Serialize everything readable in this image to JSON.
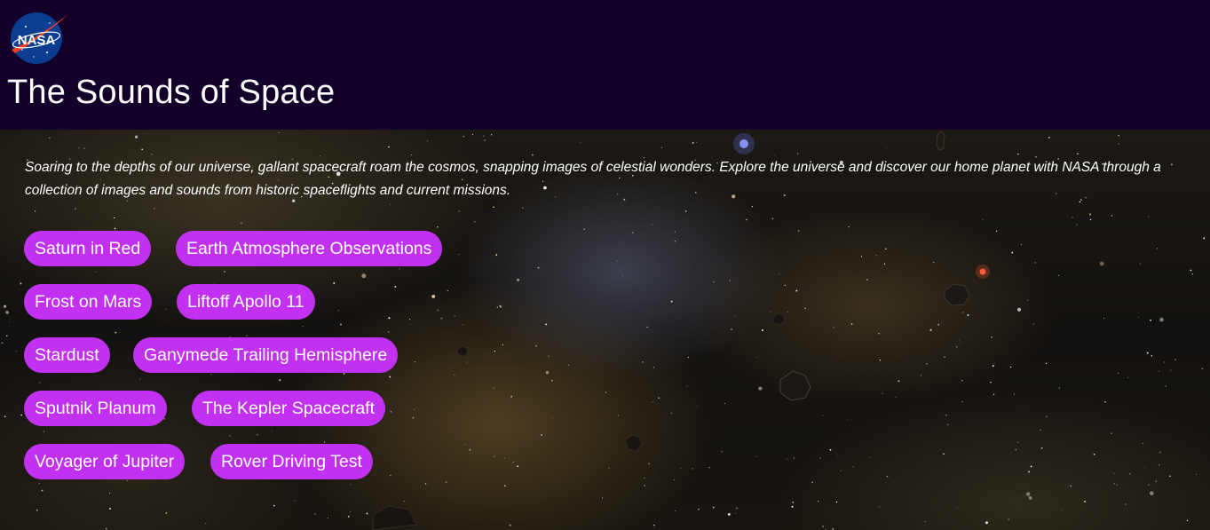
{
  "header": {
    "logo_text": "NASA",
    "title": "The Sounds of Space"
  },
  "intro": {
    "text": "Soaring to the depths of our universe, gallant spacecraft roam the cosmos, snapping images of celestial wonders. Explore the universe and discover our home planet with NASA through a collection of images and sounds from historic spaceflights and current missions."
  },
  "sounds": [
    [
      "Saturn in Red",
      "Earth Atmosphere Observations"
    ],
    [
      "Frost on Mars",
      "Liftoff Apollo 11"
    ],
    [
      "Stardust",
      "Ganymede Trailing Hemisphere"
    ],
    [
      "Sputnik Planum",
      "The Kepler Spacecraft"
    ],
    [
      "Voyager of Jupiter",
      "Rover Driving Test"
    ]
  ],
  "colors": {
    "header_bg": "#12002a",
    "button_bg": "#c231f2",
    "text": "#ffffff"
  }
}
